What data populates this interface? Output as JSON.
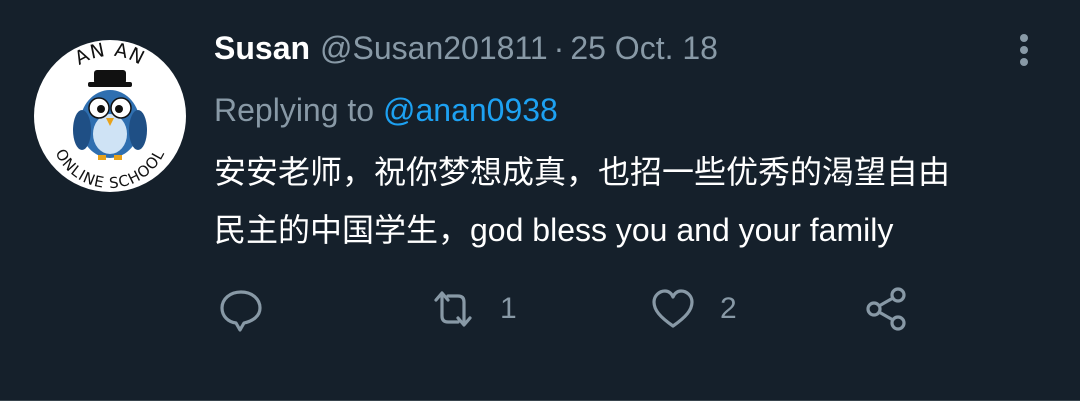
{
  "tweet": {
    "author_name": "Susan",
    "author_handle": "@Susan201811",
    "separator": "·",
    "timestamp": "25 Oct. 18",
    "replying_prefix": "Replying to",
    "replying_to": "@anan0938",
    "text_line1": "安安老师，祝你梦想成真，也招一些优秀的渴望自由",
    "text_line2": "民主的中国学生，god bless you and your family"
  },
  "avatar": {
    "text_top": "AN AN",
    "text_bottom": "ONLINE SCHOOL"
  },
  "actions": {
    "reply": {
      "icon": "reply-icon",
      "count": ""
    },
    "retweet": {
      "icon": "retweet-icon",
      "count": "1"
    },
    "like": {
      "icon": "heart-icon",
      "count": "2"
    },
    "share": {
      "icon": "share-icon",
      "count": ""
    }
  },
  "colors": {
    "background": "#15202b",
    "primary_text": "#ffffff",
    "secondary_text": "#8899a6",
    "link": "#1da1f2",
    "divider": "#38444d"
  }
}
